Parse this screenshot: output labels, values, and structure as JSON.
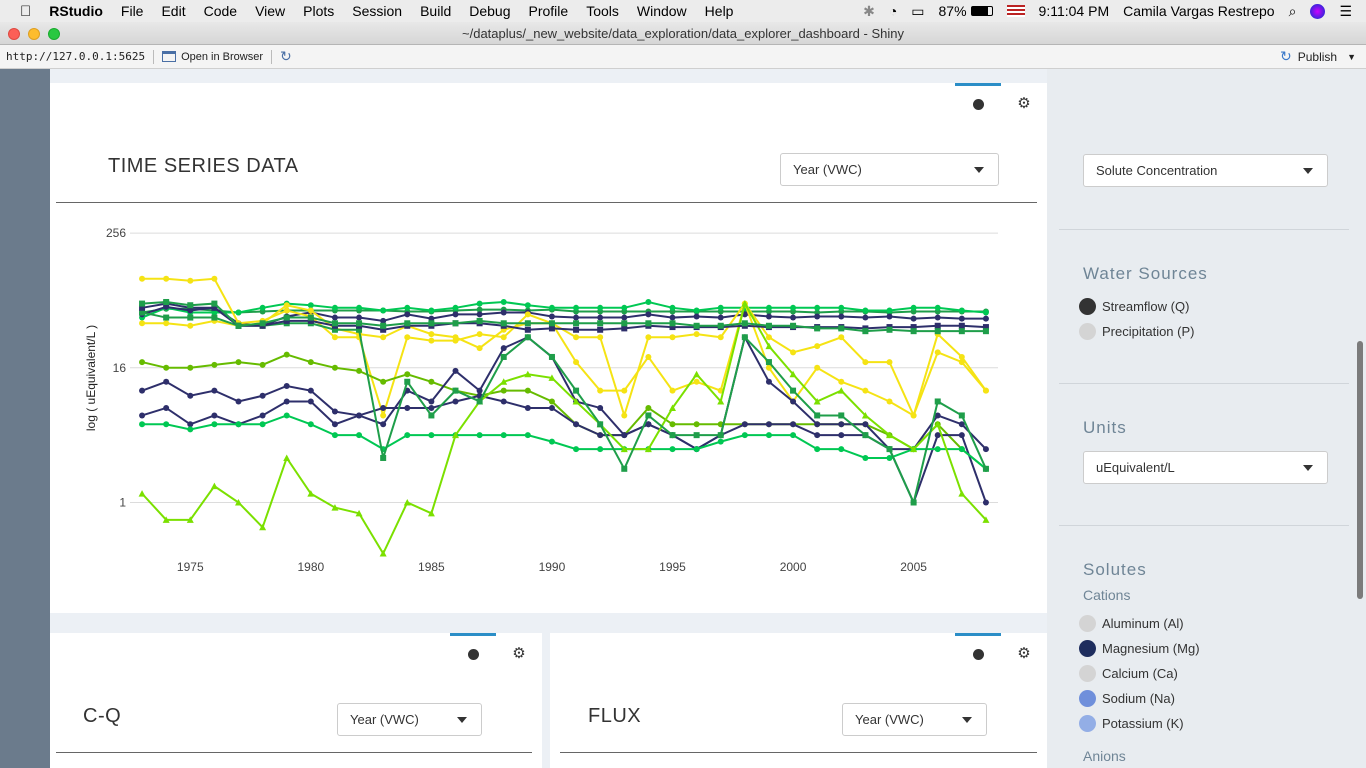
{
  "menubar": {
    "app": "RStudio",
    "items": [
      "File",
      "Edit",
      "Code",
      "View",
      "Plots",
      "Session",
      "Build",
      "Debug",
      "Profile",
      "Tools",
      "Window",
      "Help"
    ],
    "battery": "87%",
    "clock": "9:11:04 PM",
    "user": "Camila Vargas Restrepo"
  },
  "window": {
    "title": "~/dataplus/_new_website/data_exploration/data_explorer_dashboard - Shiny"
  },
  "viewer": {
    "url": "http://127.0.0.1:5625",
    "open_browser": "Open in Browser",
    "publish": "Publish"
  },
  "main_panel": {
    "title": "TIME SERIES DATA",
    "select_value": "Year (VWC)"
  },
  "chart_data": {
    "type": "line",
    "ylabel": "log ( uEquivalent/L )",
    "yscale": "log2",
    "yticks": [
      "256",
      "16",
      "1"
    ],
    "ytick_values": [
      256,
      16,
      1
    ],
    "xticks": [
      "1975",
      "1980",
      "1985",
      "1990",
      "1995",
      "2000",
      "2005"
    ],
    "xtick_values": [
      1975,
      1980,
      1985,
      1990,
      1995,
      2000,
      2005
    ],
    "xlim": [
      1972.5,
      2008.5
    ],
    "ylim_log2": [
      -1.5,
      8.3
    ],
    "x": [
      1973,
      1974,
      1975,
      1976,
      1977,
      1978,
      1979,
      1980,
      1981,
      1982,
      1983,
      1984,
      1985,
      1986,
      1987,
      1988,
      1989,
      1990,
      1991,
      1992,
      1993,
      1994,
      1995,
      1996,
      1997,
      1998,
      1999,
      2000,
      2001,
      2002,
      2003,
      2004,
      2005,
      2006,
      2007,
      2008
    ],
    "series": [
      {
        "color": "#1f9e4a",
        "marker": "circle",
        "values": [
          50,
          54,
          54,
          52,
          50,
          51,
          52,
          52,
          52,
          52,
          52,
          51,
          51,
          52,
          53,
          53,
          52,
          53,
          51,
          51,
          51,
          51,
          51,
          51,
          51,
          51,
          51,
          51,
          50,
          51,
          51,
          50,
          51,
          51,
          51,
          51
        ]
      },
      {
        "color": "#00c853",
        "marker": "circle",
        "values": [
          45,
          55,
          50,
          50,
          50,
          55,
          60,
          58,
          55,
          55,
          52,
          55,
          52,
          55,
          60,
          62,
          58,
          55,
          55,
          55,
          55,
          62,
          55,
          52,
          55,
          55,
          55,
          55,
          55,
          55,
          52,
          52,
          55,
          55,
          52,
          50
        ]
      },
      {
        "color": "#2e2f6b",
        "marker": "circle",
        "values": [
          48,
          56,
          52,
          55,
          40,
          38,
          46,
          50,
          45,
          45,
          42,
          48,
          44,
          48,
          48,
          50,
          50,
          46,
          45,
          45,
          45,
          48,
          45,
          46,
          45,
          48,
          46,
          45,
          46,
          46,
          45,
          46,
          44,
          45,
          44,
          44
        ]
      },
      {
        "color": "#f5e314",
        "marker": "circle",
        "values": [
          100,
          100,
          96,
          100,
          40,
          42,
          52,
          46,
          30,
          30,
          6,
          30,
          28,
          28,
          32,
          30,
          48,
          40,
          30,
          30,
          6,
          30,
          30,
          32,
          30,
          60,
          30,
          22,
          25,
          30,
          18,
          18,
          6,
          22,
          18,
          10
        ]
      },
      {
        "color": "#f5e314",
        "marker": "circle",
        "values": [
          40,
          40,
          38,
          42,
          38,
          40,
          58,
          52,
          36,
          32,
          30,
          38,
          32,
          30,
          24,
          35,
          40,
          40,
          18,
          10,
          10,
          20,
          10,
          12,
          10,
          60,
          16,
          8,
          16,
          12,
          10,
          8,
          6,
          32,
          20,
          10
        ]
      },
      {
        "color": "#66bb00",
        "marker": "circle",
        "values": [
          18,
          16,
          16,
          17,
          18,
          17,
          21,
          18,
          16,
          15,
          12,
          14,
          12,
          10,
          9,
          10,
          10,
          8,
          5,
          4,
          4,
          7,
          5,
          5,
          5,
          5,
          5,
          5,
          5,
          5,
          5,
          4,
          3,
          5,
          3,
          2
        ]
      },
      {
        "color": "#2e2f6b",
        "marker": "circle",
        "values": [
          10,
          12,
          9,
          10,
          8,
          9,
          11,
          10,
          6.5,
          6,
          5,
          10,
          8,
          15,
          10,
          24,
          30,
          20,
          8,
          7,
          4,
          5,
          4,
          3,
          4,
          30,
          12,
          8,
          5,
          5,
          5,
          3,
          1,
          4,
          4,
          1
        ]
      },
      {
        "color": "#2e2f6b",
        "marker": "circle",
        "values": [
          6,
          7,
          5,
          6,
          5,
          6,
          8,
          8,
          5,
          6,
          7,
          7,
          7,
          8,
          9,
          8,
          7,
          7,
          5,
          4,
          4,
          5,
          4,
          3,
          4,
          5,
          5,
          5,
          4,
          4,
          4,
          3,
          3,
          6,
          5,
          3
        ]
      },
      {
        "color": "#00c853",
        "marker": "circle",
        "values": [
          5,
          5,
          4.5,
          5,
          5,
          5,
          6,
          5,
          4,
          4,
          3,
          4,
          4,
          4,
          4,
          4,
          4,
          3.5,
          3,
          3,
          3,
          3,
          3,
          3,
          3.5,
          4,
          4,
          4,
          3,
          3,
          2.5,
          2.5,
          3,
          3,
          3,
          2
        ]
      },
      {
        "color": "#7be000",
        "marker": "triangle",
        "values": [
          1.2,
          0.7,
          0.7,
          1.4,
          1.0,
          0.6,
          2.5,
          1.2,
          0.9,
          0.8,
          0.35,
          1.0,
          0.8,
          4,
          8,
          12,
          14,
          13,
          8,
          5,
          3,
          3,
          7,
          14,
          8,
          60,
          25,
          14,
          8,
          10,
          6,
          4,
          3,
          5,
          1.2,
          0.7
        ]
      },
      {
        "color": "#1f9e4a",
        "marker": "square",
        "values": [
          50,
          45,
          45,
          45,
          38,
          38,
          40,
          40,
          35,
          35,
          2.5,
          12,
          6,
          10,
          8,
          20,
          30,
          20,
          10,
          5,
          2,
          6,
          4,
          4,
          4,
          30,
          18,
          10,
          6,
          6,
          4,
          3,
          1,
          8,
          6,
          2
        ]
      },
      {
        "color": "#2e2f6b",
        "marker": "square",
        "values": [
          55,
          60,
          55,
          55,
          38,
          38,
          42,
          42,
          38,
          38,
          35,
          38,
          38,
          40,
          40,
          38,
          35,
          36,
          35,
          35,
          36,
          38,
          37,
          37,
          37,
          38,
          37,
          37,
          37,
          37,
          36,
          37,
          37,
          38,
          38,
          37
        ]
      },
      {
        "color": "#1f9e4a",
        "marker": "square",
        "values": [
          60,
          62,
          58,
          60,
          38,
          40,
          45,
          45,
          40,
          40,
          38,
          40,
          40,
          40,
          42,
          40,
          40,
          40,
          40,
          40,
          40,
          40,
          40,
          38,
          38,
          40,
          38,
          38,
          36,
          36,
          34,
          35,
          34,
          34,
          34,
          34
        ]
      }
    ]
  },
  "cq_panel": {
    "title": "C-Q",
    "select_value": "Year (VWC)"
  },
  "flux_panel": {
    "title": "FLUX",
    "select_value": "Year (VWC)"
  },
  "sidebar": {
    "data_type_select": "Solute Concentration",
    "water_sources": {
      "heading": "Water Sources",
      "options": [
        {
          "label": "Streamflow (Q)",
          "color": "#333333"
        },
        {
          "label": "Precipitation (P)",
          "color": "#d4d4d4"
        }
      ]
    },
    "units": {
      "heading": "Units",
      "select_value": "uEquivalent/L"
    },
    "solutes": {
      "heading": "Solutes",
      "cations_label": "Cations",
      "options": [
        {
          "label": "Aluminum (Al)",
          "color": "#d4d4d4"
        },
        {
          "label": "Magnesium (Mg)",
          "color": "#1e2d5e"
        },
        {
          "label": "Calcium (Ca)",
          "color": "#d4d4d4"
        },
        {
          "label": "Sodium (Na)",
          "color": "#6f8fdb"
        },
        {
          "label": "Potassium (K)",
          "color": "#93aee6"
        }
      ],
      "anions_label": "Anions"
    }
  }
}
